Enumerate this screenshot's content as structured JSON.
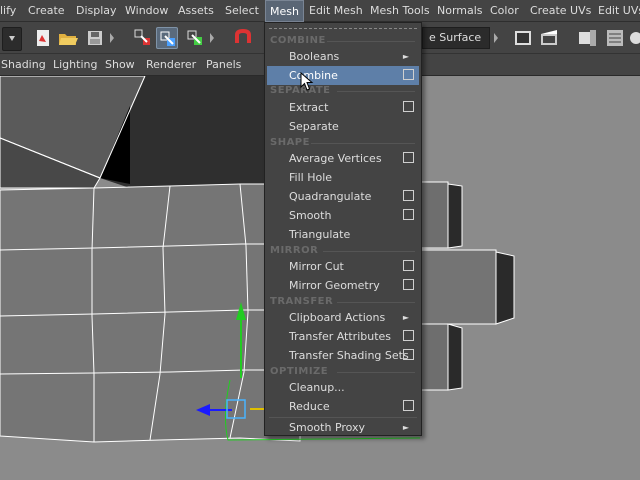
{
  "menubar": {
    "items": [
      "lify",
      "Create",
      "Display",
      "Window",
      "Assets",
      "Select",
      "Mesh",
      "Edit Mesh",
      "Mesh Tools",
      "Normals",
      "Color",
      "Create UVs",
      "Edit UVs"
    ],
    "active": "Mesh"
  },
  "toolbar": {
    "field_text": "e Surface"
  },
  "panelbar": {
    "items": [
      "Shading",
      "Lighting",
      "Show",
      "Renderer",
      "Panels"
    ]
  },
  "mesh_menu": {
    "sections": {
      "combine": "COMBINE",
      "separate": "SEPARATE",
      "shape": "SHAPE",
      "mirror": "MIRROR",
      "transfer": "TRANSFER",
      "optimize": "OPTIMIZE"
    },
    "items": {
      "booleans": "Booleans",
      "combine": "Combine",
      "extract": "Extract",
      "separate": "Separate",
      "average_vertices": "Average Vertices",
      "fill_hole": "Fill Hole",
      "quadrangulate": "Quadrangulate",
      "smooth": "Smooth",
      "triangulate": "Triangulate",
      "mirror_cut": "Mirror Cut",
      "mirror_geometry": "Mirror Geometry",
      "clipboard_actions": "Clipboard Actions",
      "transfer_attributes": "Transfer Attributes",
      "transfer_shading_sets": "Transfer Shading Sets",
      "cleanup": "Cleanup...",
      "reduce": "Reduce",
      "smooth_proxy": "Smooth Proxy"
    },
    "highlighted": "Combine"
  },
  "colors": {
    "menu_bg": "#444444",
    "highlight": "#5e7fa8",
    "viewport_bg": "#8b8b8b",
    "wire": "#ffffff",
    "manip_y": "#22cc22",
    "manip_x": "#1a1aff"
  }
}
